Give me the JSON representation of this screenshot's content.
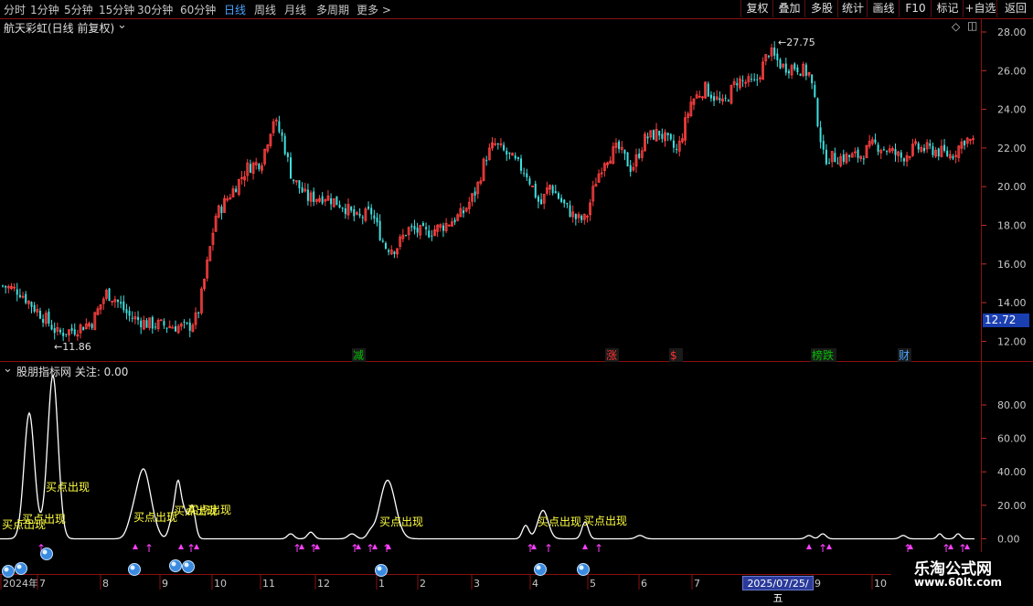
{
  "toolbar": {
    "periods": [
      "分时",
      "1分钟",
      "5分钟",
      "15分钟",
      "30分钟",
      "60分钟",
      "日线",
      "周线",
      "月线",
      "多周期",
      "更多"
    ],
    "active_period": "日线",
    "buttons": [
      "复权",
      "叠加",
      "多股",
      "统计",
      "画线",
      "F10",
      "标记",
      "+自选",
      "返回"
    ]
  },
  "main_panel": {
    "title": "航天彩虹(日线 前复权)",
    "current_price": "12.72",
    "high_label": "27.75",
    "low_label": "11.86",
    "price_axis": [
      "28.00",
      "26.00",
      "24.00",
      "22.00",
      "20.00",
      "18.00",
      "16.00",
      "14.00",
      "12.00"
    ],
    "event_markers": [
      {
        "text": "减",
        "color": "#00c000"
      },
      {
        "text": "涨",
        "color": "#ff3030"
      },
      {
        "text": "$",
        "color": "#ff3030"
      },
      {
        "text": "榜跌",
        "color": "#00c000"
      },
      {
        "text": "财",
        "color": "#4aa3ff"
      }
    ]
  },
  "indicator_panel": {
    "title": "股朋指标网 关注: 0.00",
    "axis": [
      "80.00",
      "60.00",
      "40.00",
      "20.00",
      "0.00"
    ],
    "signal_label": "买点出现"
  },
  "time_axis": {
    "labels": [
      "2024年",
      "7",
      "8",
      "9",
      "10",
      "11",
      "12",
      "1",
      "2",
      "3",
      "4",
      "5",
      "6",
      "7",
      "9",
      "10"
    ],
    "selected_date": "2025/07/25/五"
  },
  "watermark": {
    "name": "乐淘公式网",
    "url": "www.60lt.com"
  },
  "colors": {
    "up": "#ff4040",
    "down": "#40e0e0",
    "indicator_line": "#ffffff",
    "signal_text": "#ffff40",
    "arrow": "#ff40ff",
    "panel_border": "#8a1010"
  }
}
